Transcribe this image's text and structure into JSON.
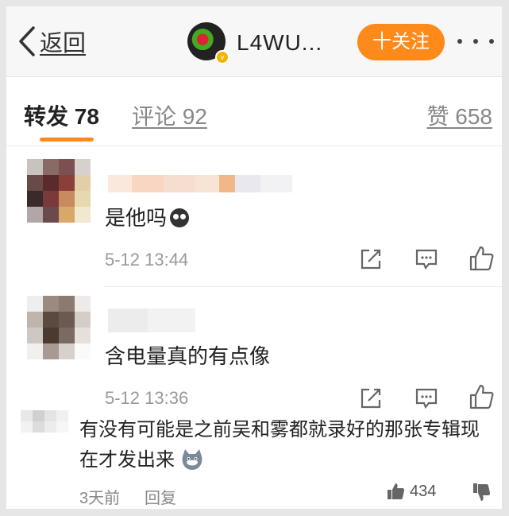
{
  "header": {
    "back_label": "返回",
    "username": "L4WU...",
    "follow_label": "十关注"
  },
  "tabs": {
    "repost": "转发 78",
    "comment": "评论 92",
    "like": "赞 658"
  },
  "comments": [
    {
      "text": "是他吗",
      "time": "5-12 13:44"
    },
    {
      "text": "含电量真的有点像",
      "time": "5-12 13:36"
    }
  ],
  "reply": {
    "text": "有没有可能是之前吴和雾都就录好的那张专辑现在才发出来",
    "time": "3天前",
    "reply_label": "回复",
    "like_count": "434"
  },
  "colors": {
    "accent": "#ff8a1c",
    "text": "#222222",
    "muted": "#999999"
  },
  "icons": [
    "chevron-left-icon",
    "more-dots-icon",
    "share-icon",
    "comment-icon",
    "thumbs-up-icon",
    "thumbs-down-icon"
  ]
}
